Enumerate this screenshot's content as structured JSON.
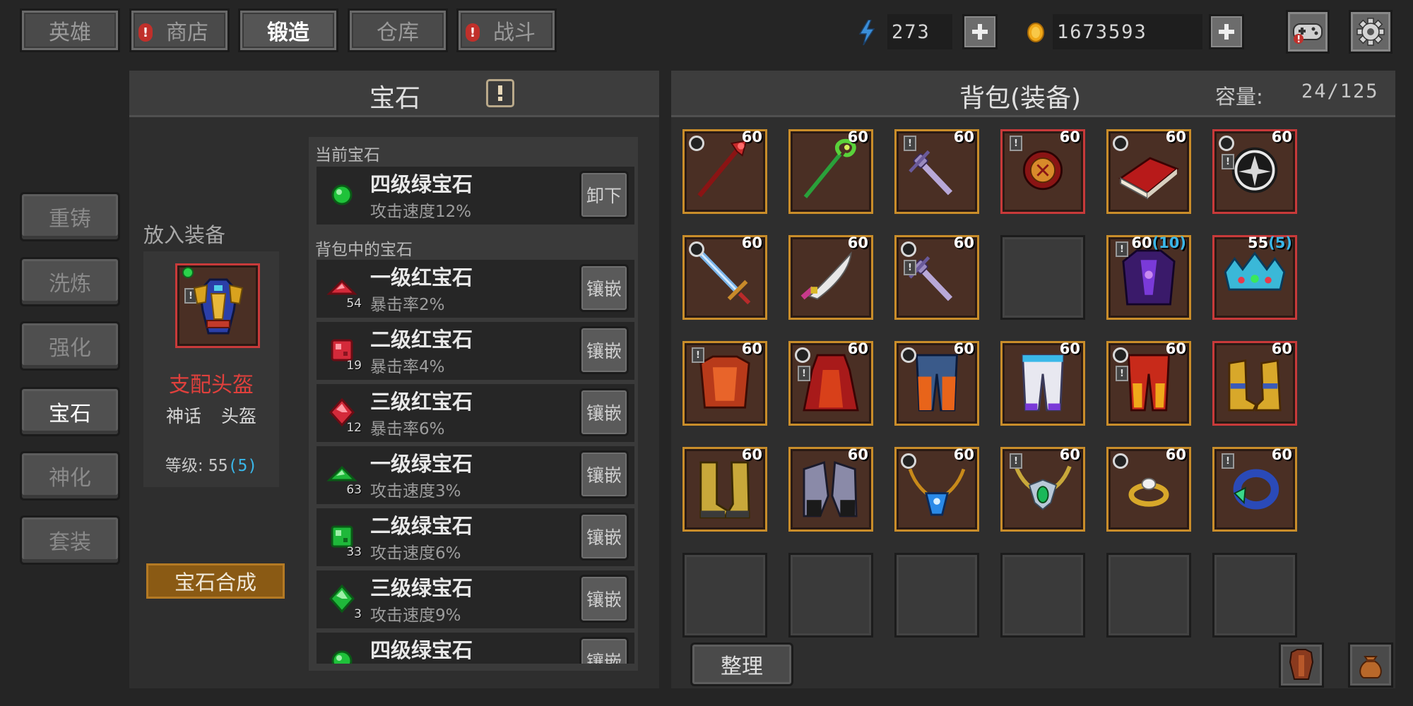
{
  "top_tabs": [
    {
      "label": "英雄",
      "alert": false
    },
    {
      "label": "商店",
      "alert": true
    },
    {
      "label": "锻造",
      "alert": false,
      "active": true
    },
    {
      "label": "仓库",
      "alert": false
    },
    {
      "label": "战斗",
      "alert": true
    }
  ],
  "resources": {
    "energy": "273",
    "gold": "1673593"
  },
  "side_menu": [
    {
      "label": "重铸"
    },
    {
      "label": "洗炼"
    },
    {
      "label": "强化"
    },
    {
      "label": "宝石",
      "active": true
    },
    {
      "label": "神化"
    },
    {
      "label": "套装"
    }
  ],
  "gem_panel": {
    "title": "宝石",
    "place_equipment_label": "放入装备",
    "equipment": {
      "name": "支配头盔",
      "rarity": "神话",
      "type": "头盔",
      "level_label": "等级:",
      "level": "55",
      "level_bonus": "(5)"
    },
    "synthesis_button": "宝石合成",
    "current_section_label": "当前宝石",
    "current_gem": {
      "name": "四级绿宝石",
      "desc": "攻击速度12%",
      "button": "卸下",
      "icon": "green-orb"
    },
    "bag_section_label": "背包中的宝石",
    "bag_gems": [
      {
        "name": "一级红宝石",
        "desc": "暴击率2%",
        "count": "54",
        "button": "镶嵌",
        "icon": "red-gem-1"
      },
      {
        "name": "二级红宝石",
        "desc": "暴击率4%",
        "count": "19",
        "button": "镶嵌",
        "icon": "red-gem-2"
      },
      {
        "name": "三级红宝石",
        "desc": "暴击率6%",
        "count": "12",
        "button": "镶嵌",
        "icon": "red-gem-3"
      },
      {
        "name": "一级绿宝石",
        "desc": "攻击速度3%",
        "count": "63",
        "button": "镶嵌",
        "icon": "green-gem-1"
      },
      {
        "name": "二级绿宝石",
        "desc": "攻击速度6%",
        "count": "33",
        "button": "镶嵌",
        "icon": "green-gem-2"
      },
      {
        "name": "三级绿宝石",
        "desc": "攻击速度9%",
        "count": "3",
        "button": "镶嵌",
        "icon": "green-gem-3"
      },
      {
        "name": "四级绿宝石",
        "desc": "",
        "count": "",
        "button": "镶嵌",
        "icon": "green-orb"
      }
    ]
  },
  "backpack": {
    "title": "背包(装备)",
    "capacity_label": "容量:",
    "capacity": "24/125",
    "sort_button": "整理",
    "items": [
      {
        "name": "crimson-staff",
        "level": "60",
        "border": "gold",
        "marker": "ring"
      },
      {
        "name": "green-staff",
        "level": "60",
        "border": "gold"
      },
      {
        "name": "violet-dagger",
        "level": "60",
        "border": "gold",
        "marker": "tag"
      },
      {
        "name": "red-amulet",
        "level": "60",
        "border": "red",
        "marker": "tag"
      },
      {
        "name": "red-tome",
        "level": "60",
        "border": "gold",
        "marker": "ring"
      },
      {
        "name": "dark-orb",
        "level": "60",
        "border": "red",
        "marker": "ring-tag"
      },
      {
        "name": "blue-sword",
        "level": "60",
        "border": "gold",
        "marker": "ring"
      },
      {
        "name": "curved-dagger",
        "level": "60",
        "border": "gold"
      },
      {
        "name": "violet-dagger",
        "level": "60",
        "border": "gold",
        "marker": "ring-tag"
      },
      {
        "name": "empty",
        "level": "",
        "border": "empty"
      },
      {
        "name": "purple-armor",
        "level": "60",
        "bonus": "(10)",
        "border": "gold",
        "marker": "tag"
      },
      {
        "name": "jeweled-crown",
        "level": "55",
        "bonus": "(5)",
        "border": "red"
      },
      {
        "name": "red-armor",
        "level": "60",
        "border": "gold",
        "marker": "tag"
      },
      {
        "name": "red-robe",
        "level": "60",
        "border": "gold",
        "marker": "ring-tag"
      },
      {
        "name": "orange-leggings",
        "level": "60",
        "border": "gold",
        "marker": "ring"
      },
      {
        "name": "white-leggings",
        "level": "60",
        "border": "gold"
      },
      {
        "name": "flame-leggings",
        "level": "60",
        "border": "gold",
        "marker": "ring-tag"
      },
      {
        "name": "gold-boots",
        "level": "60",
        "border": "red"
      },
      {
        "name": "plated-boots",
        "level": "60",
        "border": "gold"
      },
      {
        "name": "steel-gauntlets",
        "level": "60",
        "border": "gold"
      },
      {
        "name": "blue-pendant",
        "level": "60",
        "border": "gold",
        "marker": "ring"
      },
      {
        "name": "emerald-necklace",
        "level": "60",
        "border": "gold",
        "marker": "tag"
      },
      {
        "name": "gold-ring",
        "level": "60",
        "border": "gold",
        "marker": "ring"
      },
      {
        "name": "blue-ring",
        "level": "60",
        "border": "gold",
        "marker": "tag"
      },
      {
        "name": "empty",
        "level": "",
        "border": "empty"
      },
      {
        "name": "empty",
        "level": "",
        "border": "empty"
      },
      {
        "name": "empty",
        "level": "",
        "border": "empty"
      },
      {
        "name": "empty",
        "level": "",
        "border": "empty"
      },
      {
        "name": "empty",
        "level": "",
        "border": "empty"
      },
      {
        "name": "empty",
        "level": "",
        "border": "empty"
      }
    ]
  },
  "colors": {
    "item_name_mythic": "#e0403c",
    "level_bonus": "#3ab6e8",
    "gold_border": "#c98d2a",
    "red_border": "#c83a3a",
    "synthesis_button": "#8a5a14"
  }
}
